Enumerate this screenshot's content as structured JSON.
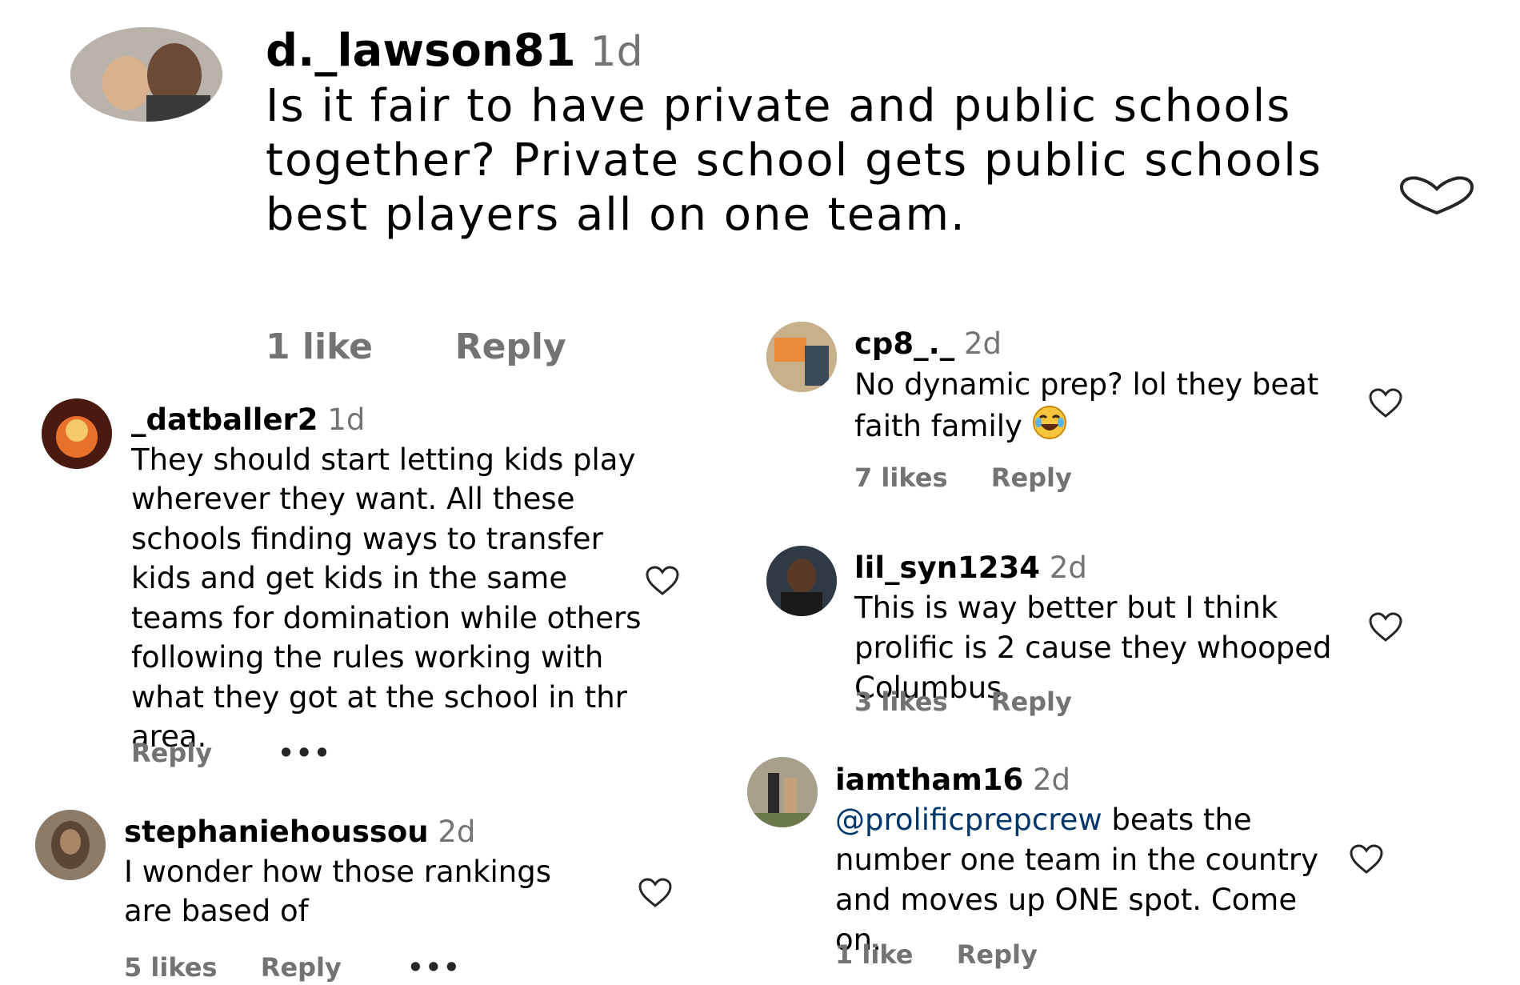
{
  "comments": [
    {
      "username": "d._lawson81",
      "time": "1d",
      "text": "Is it fair to have private and public schools together? Private school gets public schools best players all on one team.",
      "likes": "1 like",
      "reply": "Reply"
    },
    {
      "username": "_datballer2",
      "time": "1d",
      "text": "They should start letting kids play wherever they want. All these schools finding ways to transfer kids and get kids in the same teams for domination while others following the rules working with what they got at the school in thr area.",
      "reply": "Reply",
      "more": "•••"
    },
    {
      "username": "stephaniehoussou",
      "time": "2d",
      "text": "I wonder how those rankings are based of",
      "likes": "5 likes",
      "reply": "Reply",
      "more": "•••"
    },
    {
      "username": "cp8_._",
      "time": "2d",
      "text": "No dynamic prep? lol they beat faith family",
      "emoji": "😂",
      "likes": "7 likes",
      "reply": "Reply"
    },
    {
      "username": "lil_syn1234",
      "time": "2d",
      "text": "This is way better but I think prolific is 2 cause they whooped Columbus",
      "likes": "3 likes",
      "reply": "Reply"
    },
    {
      "username": "iamtham16",
      "time": "2d",
      "mention": "@prolificprepcrew",
      "text": " beats the number one team in the country and moves up ONE spot. Come on.",
      "likes": "1 like",
      "reply": "Reply"
    }
  ],
  "icons": {
    "like": "heart-outline-icon",
    "more": "more-dots-icon"
  },
  "colors": {
    "meta": "#737373",
    "mention": "#00376b",
    "heart": "#262626"
  }
}
